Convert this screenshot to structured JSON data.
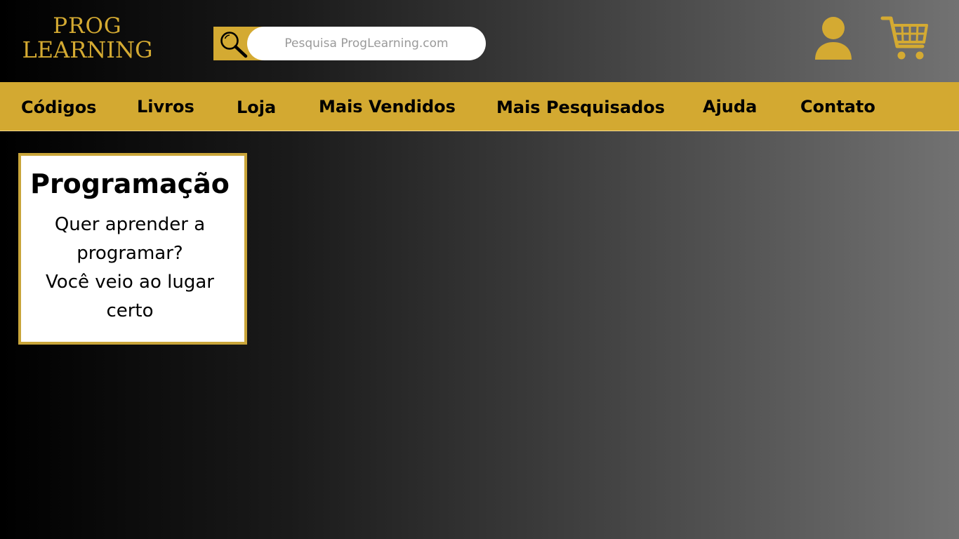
{
  "header": {
    "logo": {
      "line1": "PROG",
      "line2": "LEARNING"
    },
    "search": {
      "placeholder": "Pesquisa ProgLearning.com",
      "value": "",
      "button_icon": "search-icon"
    },
    "user_icon": "user-icon",
    "cart_icon": "cart-icon"
  },
  "nav": {
    "items": [
      {
        "label": "Códigos"
      },
      {
        "label": "Livros"
      },
      {
        "label": "Loja"
      },
      {
        "label": "Mais Vendidos"
      },
      {
        "label": "Mais Pesquisados"
      },
      {
        "label": "Ajuda"
      },
      {
        "label": "Contato"
      }
    ]
  },
  "card": {
    "title": "Programação",
    "line1": "Quer aprender a",
    "line2": "programar?",
    "line3": "Você veio ao lugar",
    "line4": "certo"
  },
  "colors": {
    "accent": "#d3a931",
    "card_border": "#c9a53a",
    "background_start": "#000000",
    "background_end": "#727272"
  }
}
